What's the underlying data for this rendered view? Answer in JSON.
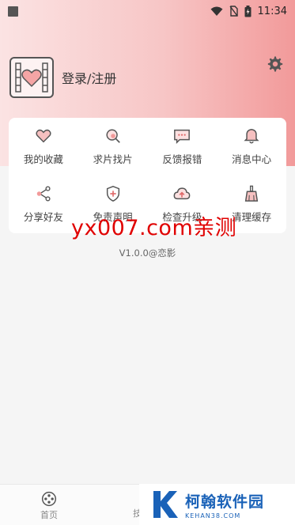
{
  "status_bar": {
    "time": "11:34"
  },
  "profile": {
    "label": "登录/注册",
    "avatar_icon": "heart-film-icon"
  },
  "settings": {
    "icon": "gear-icon"
  },
  "menu": [
    {
      "label": "我的收藏",
      "icon": "heart-icon"
    },
    {
      "label": "求片找片",
      "icon": "search-icon"
    },
    {
      "label": "反馈报错",
      "icon": "message-icon"
    },
    {
      "label": "消息中心",
      "icon": "bell-icon"
    },
    {
      "label": "分享好友",
      "icon": "share-icon"
    },
    {
      "label": "免责声明",
      "icon": "shield-icon"
    },
    {
      "label": "检查升级",
      "icon": "cloud-upload-icon"
    },
    {
      "label": "清理缓存",
      "icon": "broom-icon"
    }
  ],
  "version": "V1.0.0@恋影",
  "watermark": "yx007.com亲测",
  "bottom_nav": {
    "home_label": "首页",
    "partial_label": "技"
  },
  "corner_logo": {
    "title": "柯翰软件园",
    "url": "KEHAN38.COM"
  },
  "colors": {
    "accent": "#e06a6a",
    "icon_gray": "#555555",
    "watermark": "#e00000"
  }
}
